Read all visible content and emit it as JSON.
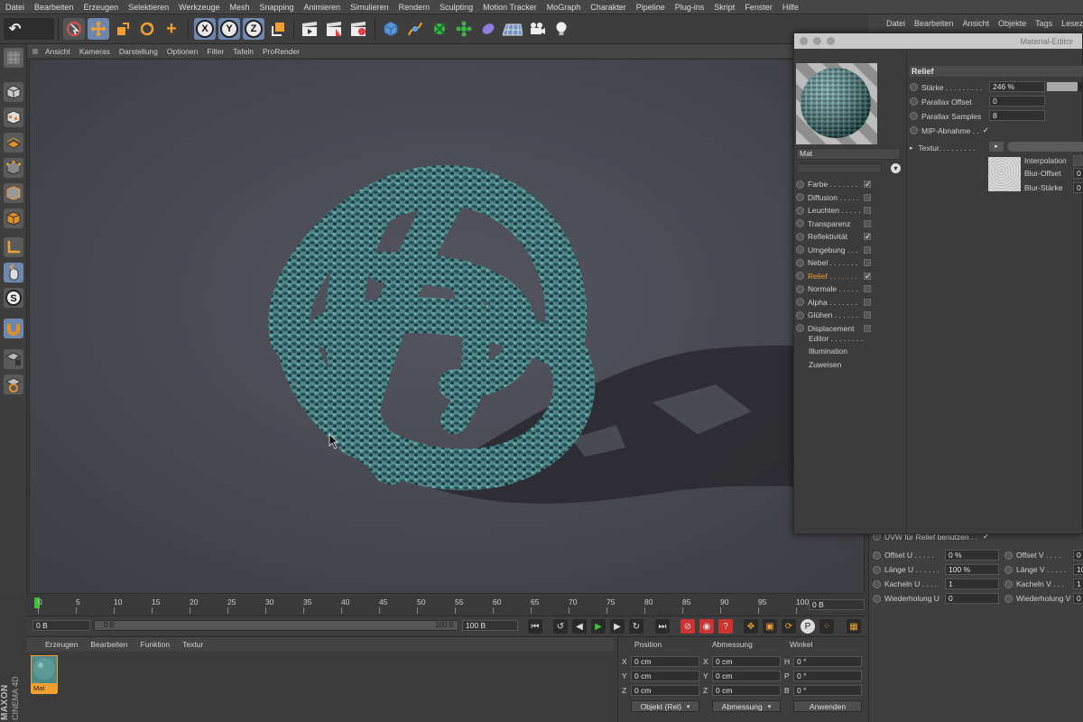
{
  "menu": [
    "Datei",
    "Bearbeiten",
    "Erzeugen",
    "Selektieren",
    "Werkzeuge",
    "Mesh",
    "Snapping",
    "Animieren",
    "Simulieren",
    "Rendern",
    "Sculpting",
    "Motion Tracker",
    "MoGraph",
    "Charakter",
    "Pipeline",
    "Plug-ins",
    "Skript",
    "Fenster",
    "Hilfe"
  ],
  "toolbar": {
    "x": "X",
    "y": "Y",
    "z": "Z"
  },
  "viewport_menu": [
    "Ansicht",
    "Kameras",
    "Darstellung",
    "Optionen",
    "Filter",
    "Tafeln",
    "ProRender"
  ],
  "right_menu": [
    "Datei",
    "Bearbeiten",
    "Ansicht",
    "Objekte",
    "Tags",
    "Lesez"
  ],
  "material_editor": {
    "title": "Material-Editor",
    "material_name": "Mat",
    "channels": [
      {
        "label": "Farbe . . . . . . .",
        "checked": "✓"
      },
      {
        "label": "Diffusion . . . . .",
        "checked": ""
      },
      {
        "label": "Leuchten . . . . .",
        "checked": ""
      },
      {
        "label": "Transparenz",
        "checked": ""
      },
      {
        "label": "Reflektivität",
        "checked": "✓"
      },
      {
        "label": "Umgebung . . .",
        "checked": ""
      },
      {
        "label": "Nebel . . . . . . .",
        "checked": ""
      },
      {
        "label": "Relief . . . . . . .",
        "checked": "✓"
      },
      {
        "label": "Normale . . . . .",
        "checked": ""
      },
      {
        "label": "Alpha . . . . . . .",
        "checked": ""
      },
      {
        "label": "Glühen . . . . . .",
        "checked": ""
      },
      {
        "label": "Displacement",
        "checked": ""
      }
    ],
    "extras": [
      "Editor . . . . . . . .",
      "Illumination",
      "Zuweisen"
    ],
    "section": "Relief",
    "props": {
      "staerke_label": "Stärke . . . . . . . . .",
      "staerke_value": "246 %",
      "staerke_level": 0.82,
      "parallax_offset_label": "Parallax Offset",
      "parallax_offset_value": "0",
      "parallax_samples_label": "Parallax Samples",
      "parallax_samples_value": "8",
      "mip_label": "MIP-Abnahme . .",
      "mip_value": "✓",
      "textur_label": "Textur. . . . . . . . .",
      "interpolation_label": "Interpolation",
      "blur_offset_label": "Blur-Offset",
      "blur_offset_value": "0",
      "blur_staerke_label": "Blur-Stärke",
      "blur_staerke_value": "0"
    }
  },
  "attributes": {
    "uvw_label": "UVW für Relief benutzen . .",
    "uvw_value": "✓",
    "offset_u_label": "Offset U . . . . .",
    "offset_u_value": "0 %",
    "offset_v_label": "Offset V . . . .",
    "offset_v_value": "0",
    "laenge_u_label": "Länge U . . . . . .",
    "laenge_u_value": "100 %",
    "laenge_v_label": "Länge V . . . . .",
    "laenge_v_value": "10",
    "kacheln_u_label": "Kacheln U . . . .",
    "kacheln_u_value": "1",
    "kacheln_v_label": "Kacheln V . . .",
    "kacheln_v_value": "1",
    "wiederholung_u_label": "Wiederholung U",
    "wiederholung_u_value": "0",
    "wiederholung_v_label": "Wiederholung V",
    "wiederholung_v_value": "0"
  },
  "timeline": {
    "ticks": [
      "0",
      "5",
      "10",
      "15",
      "20",
      "25",
      "30",
      "35",
      "40",
      "45",
      "50",
      "55",
      "60",
      "65",
      "70",
      "75",
      "80",
      "85",
      "90",
      "95",
      "100"
    ],
    "current_frame": "0 B"
  },
  "transport": {
    "start": "0 B",
    "slider_start": "0 B",
    "slider_end": "100 B",
    "end": "100 B"
  },
  "material_manager": {
    "menu": [
      "Erzeugen",
      "Bearbeiten",
      "Funktion",
      "Textur"
    ],
    "material_label": "Mat"
  },
  "brand": {
    "maxon": "MAXON",
    "cinema": "CINEMA 4D"
  },
  "coordinates": {
    "headers": [
      "Position",
      "Abmessung",
      "Winkel"
    ],
    "rows": [
      {
        "pos_axis": "X",
        "pos": "0 cm",
        "size_axis": "X",
        "size": "0 cm",
        "rot_axis": "H",
        "rot": "0 °"
      },
      {
        "pos_axis": "Y",
        "pos": "0 cm",
        "size_axis": "Y",
        "size": "0 cm",
        "rot_axis": "P",
        "rot": "0 °"
      },
      {
        "pos_axis": "Z",
        "pos": "0 cm",
        "size_axis": "Z",
        "size": "0 cm",
        "rot_axis": "B",
        "rot": "0 °"
      }
    ],
    "mode_select": "Objekt (Rel)",
    "size_select": "Abmessung",
    "apply_button": "Anwenden"
  },
  "colors": {
    "accent_orange": "#f0a030",
    "highlight_blue": "#6d86ad",
    "play_green": "#3cc23c"
  }
}
